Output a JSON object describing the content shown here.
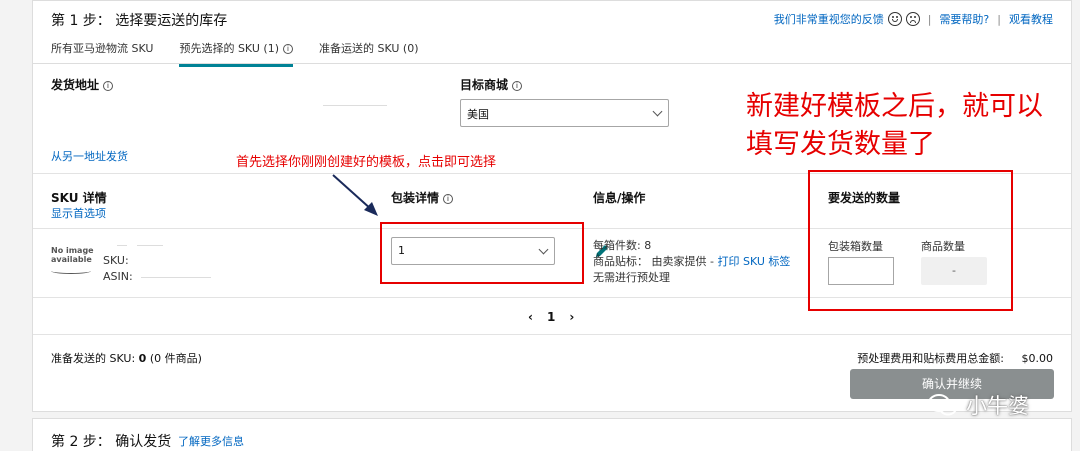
{
  "step1": {
    "title": "第 1 步： 选择要运送的库存",
    "header_links": {
      "feedback": "我们非常重视您的反馈",
      "help": "需要帮助?",
      "tutorial": "观看教程",
      "sep": "|"
    },
    "tabs": [
      {
        "label": "所有亚马逊物流 SKU",
        "active": false
      },
      {
        "label": "预先选择的 SKU (1)",
        "active": true
      },
      {
        "label": "准备运送的 SKU (0)",
        "active": false
      }
    ],
    "ship_from_label": "发货地址",
    "marketplace_label": "目标商城",
    "marketplace_value": "美国",
    "ship_other_link": "从另一地址发货",
    "columns": {
      "sku_details": "SKU 详情",
      "show_preferences": "显示首选项",
      "packing_details": "包装详情",
      "info_actions": "信息/操作",
      "quantity_to_send": "要发送的数量"
    },
    "row": {
      "no_image_line1": "No image",
      "no_image_line2": "available",
      "sku_label": "SKU:",
      "asin_label": "ASIN:",
      "packing_value": "1",
      "units_per_box": "每箱件数: 8",
      "prep_label": "商品贴标： 由卖家提供 -",
      "print_label_link": "打印 SKU 标签",
      "no_prep": "无需进行预处理",
      "box_qty_label": "包装箱数量",
      "item_qty_label": "商品数量",
      "item_qty_value": "-"
    },
    "pager": {
      "prev": "‹",
      "page": "1",
      "next": "›"
    },
    "footer": {
      "ready_label": "准备发送的 SKU:",
      "ready_count": "0",
      "ready_items": "(0 件商品)",
      "fee_label": "预处理费用和贴标费用总金额:",
      "fee_value": "$0.00",
      "confirm_button": "确认并继续"
    }
  },
  "step2": {
    "title": "第 2 步： 确认发货",
    "learn_more": "了解更多信息"
  },
  "annotations": {
    "arrow_note": "首先选择你刚刚创建好的模板，点击即可选择",
    "big_note_line1": "新建好模板之后，就可以",
    "big_note_line2": "填写发货数量了"
  },
  "watermark": "小牛婆",
  "colors": {
    "link": "#0066c0",
    "tab_active": "#008296",
    "annotation": "#e60000",
    "button_disabled": "#8a8f90"
  }
}
